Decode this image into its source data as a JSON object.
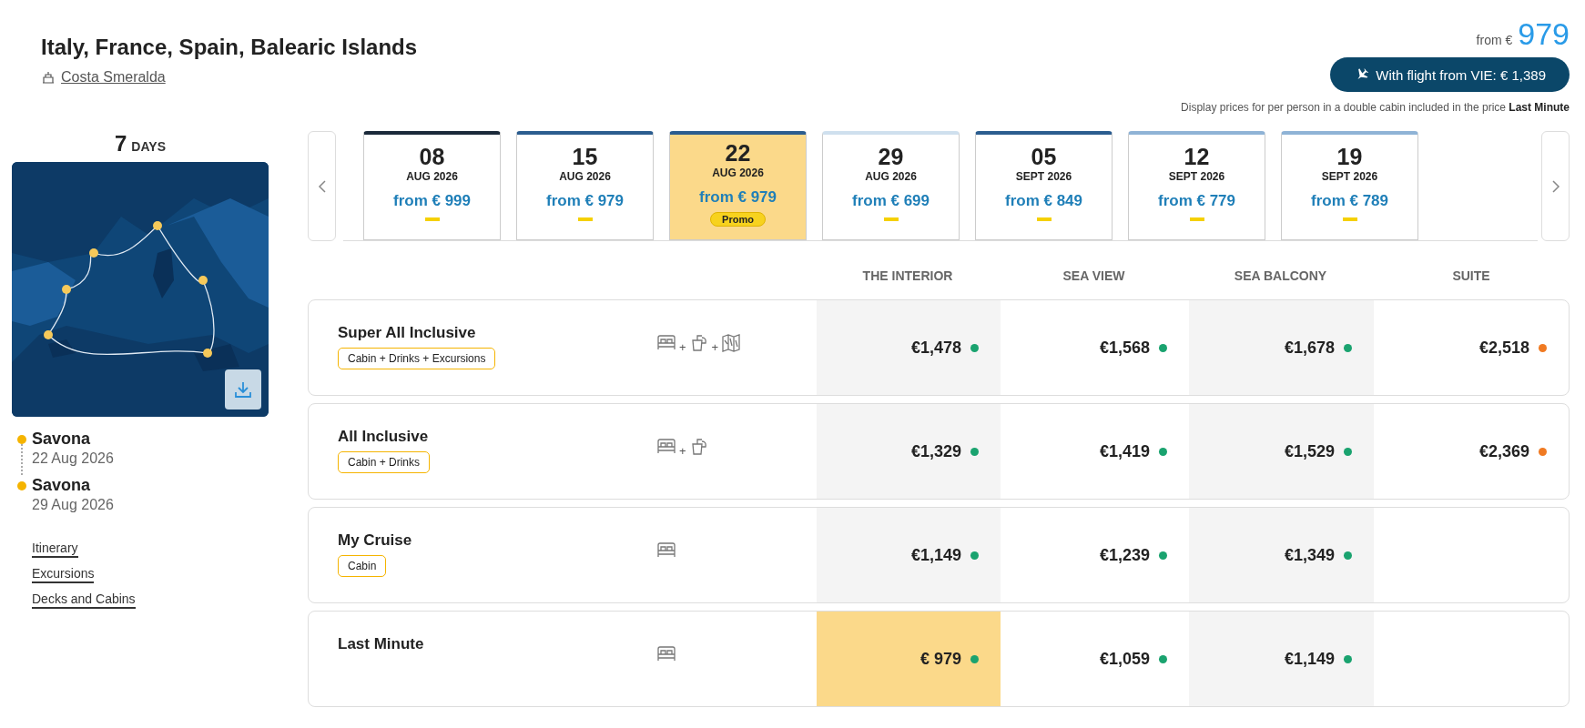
{
  "cruise": {
    "title": "Italy, France, Spain, Balearic Islands",
    "ship": "Costa Smeralda"
  },
  "price_summary": {
    "from_label": "from €",
    "price": "979",
    "flight_button": "With flight from VIE: € 1,389",
    "note": "Display prices for per person in a double cabin included in the price **Last Minute**"
  },
  "sidebar": {
    "duration_number": "7",
    "duration_unit": "DAYS",
    "map": {
      "kind": "picture"
    },
    "ports": [
      {
        "name": "Savona",
        "date": "22 Aug 2026"
      },
      {
        "name": "Savona",
        "date": "29 Aug 2026"
      }
    ],
    "links": [
      "Itinerary",
      "Excursions",
      "Decks and Cabins"
    ]
  },
  "dates": [
    {
      "day": "08",
      "month": "AUG 2026",
      "price": "from € 999",
      "selected": false,
      "color": "#1b2a3a"
    },
    {
      "day": "15",
      "month": "AUG 2026",
      "price": "from € 979",
      "selected": false,
      "color": "#2b5d8f"
    },
    {
      "day": "22",
      "month": "AUG 2026",
      "price": "from € 979",
      "selected": true,
      "badge": "Promo",
      "color": "#2b5d8f"
    },
    {
      "day": "29",
      "month": "AUG 2026",
      "price": "from € 699",
      "selected": false,
      "color": "#cfe0ee"
    },
    {
      "day": "05",
      "month": "SEPT 2026",
      "price": "from € 849",
      "selected": false,
      "color": "#2b5d8f"
    },
    {
      "day": "12",
      "month": "SEPT 2026",
      "price": "from € 779",
      "selected": false,
      "color": "#8fb3d6"
    },
    {
      "day": "19",
      "month": "SEPT 2026",
      "price": "from € 789",
      "selected": false,
      "color": "#8fb3d6"
    }
  ],
  "fare_table": {
    "columns": [
      "THE INTERIOR",
      "SEA VIEW",
      "SEA BALCONY",
      "SUITE"
    ],
    "amenity_joiner": "+",
    "rows": [
      {
        "name": "Super All Inclusive",
        "tag": "Cabin + Drinks + Excursions",
        "amenities": [
          {
            "kind": "bed"
          },
          {
            "kind": "drink"
          },
          {
            "kind": "map"
          }
        ],
        "prices": [
          {
            "value": "€1,478",
            "color": "#1aa36f",
            "selected": false
          },
          {
            "value": "€1,568",
            "color": "#1aa36f",
            "selected": false
          },
          {
            "value": "€1,678",
            "color": "#1aa36f",
            "selected": false
          },
          {
            "value": "€2,518",
            "color": "#f07a22",
            "selected": false
          }
        ]
      },
      {
        "name": "All Inclusive",
        "tag": "Cabin + Drinks",
        "amenities": [
          {
            "kind": "bed"
          },
          {
            "kind": "drink"
          }
        ],
        "prices": [
          {
            "value": "€1,329",
            "color": "#1aa36f",
            "selected": false
          },
          {
            "value": "€1,419",
            "color": "#1aa36f",
            "selected": false
          },
          {
            "value": "€1,529",
            "color": "#1aa36f",
            "selected": false
          },
          {
            "value": "€2,369",
            "color": "#f07a22",
            "selected": false
          }
        ]
      },
      {
        "name": "My Cruise",
        "tag": "Cabin",
        "amenities": [
          {
            "kind": "bed"
          }
        ],
        "prices": [
          {
            "value": "€1,149",
            "color": "#1aa36f",
            "selected": false
          },
          {
            "value": "€1,239",
            "color": "#1aa36f",
            "selected": false
          },
          {
            "value": "€1,349",
            "color": "#1aa36f",
            "selected": false
          }
        ]
      },
      {
        "name": "Last Minute",
        "amenities": [
          {
            "kind": "bed"
          }
        ],
        "prices": [
          {
            "value": "€ 979",
            "color": "#1aa36f",
            "selected": true
          },
          {
            "value": "€1,059",
            "color": "#1aa36f",
            "selected": false
          },
          {
            "value": "€1,149",
            "color": "#1aa36f",
            "selected": false
          }
        ]
      }
    ]
  }
}
